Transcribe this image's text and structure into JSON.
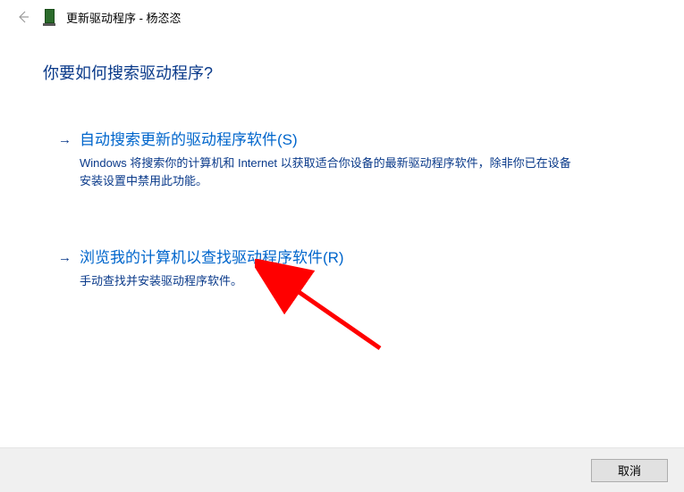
{
  "titlebar": {
    "title": "更新驱动程序 - 杨恣恣"
  },
  "heading": "你要如何搜索驱动程序?",
  "options": [
    {
      "arrow": "→",
      "title": "自动搜索更新的驱动程序软件(S)",
      "desc": "Windows 将搜索你的计算机和 Internet 以获取适合你设备的最新驱动程序软件，除非你已在设备安装设置中禁用此功能。"
    },
    {
      "arrow": "→",
      "title": "浏览我的计算机以查找驱动程序软件(R)",
      "desc": "手动查找并安装驱动程序软件。"
    }
  ],
  "footer": {
    "cancel": "取消"
  },
  "annotation": {
    "color": "#ff0000"
  }
}
